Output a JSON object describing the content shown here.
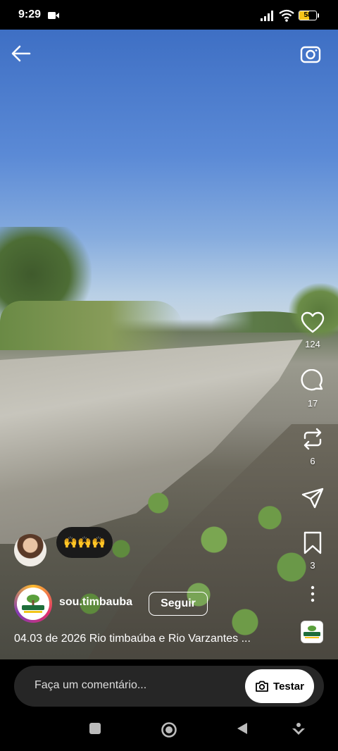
{
  "status_bar": {
    "time": "9:29",
    "battery": "58",
    "battery_level": 0.58
  },
  "reel": {
    "likes": "124",
    "comments": "17",
    "reposts": "6",
    "saves": "3",
    "featured_comment": "🙌🙌🙌",
    "author": "sou.timbauba",
    "follow_label": "Seguir",
    "caption": "04.03 de 2026 Rio timbaúba e Rio Varzantes ..."
  },
  "comment_bar": {
    "placeholder": "Faça um comentário...",
    "try_label": "Testar"
  },
  "icons": {
    "back": "back-arrow-icon",
    "camera": "camera-icon",
    "like": "heart-icon",
    "comment": "comment-icon",
    "repost": "repost-icon",
    "share": "send-icon",
    "save": "bookmark-icon",
    "more": "more-vertical-icon"
  }
}
